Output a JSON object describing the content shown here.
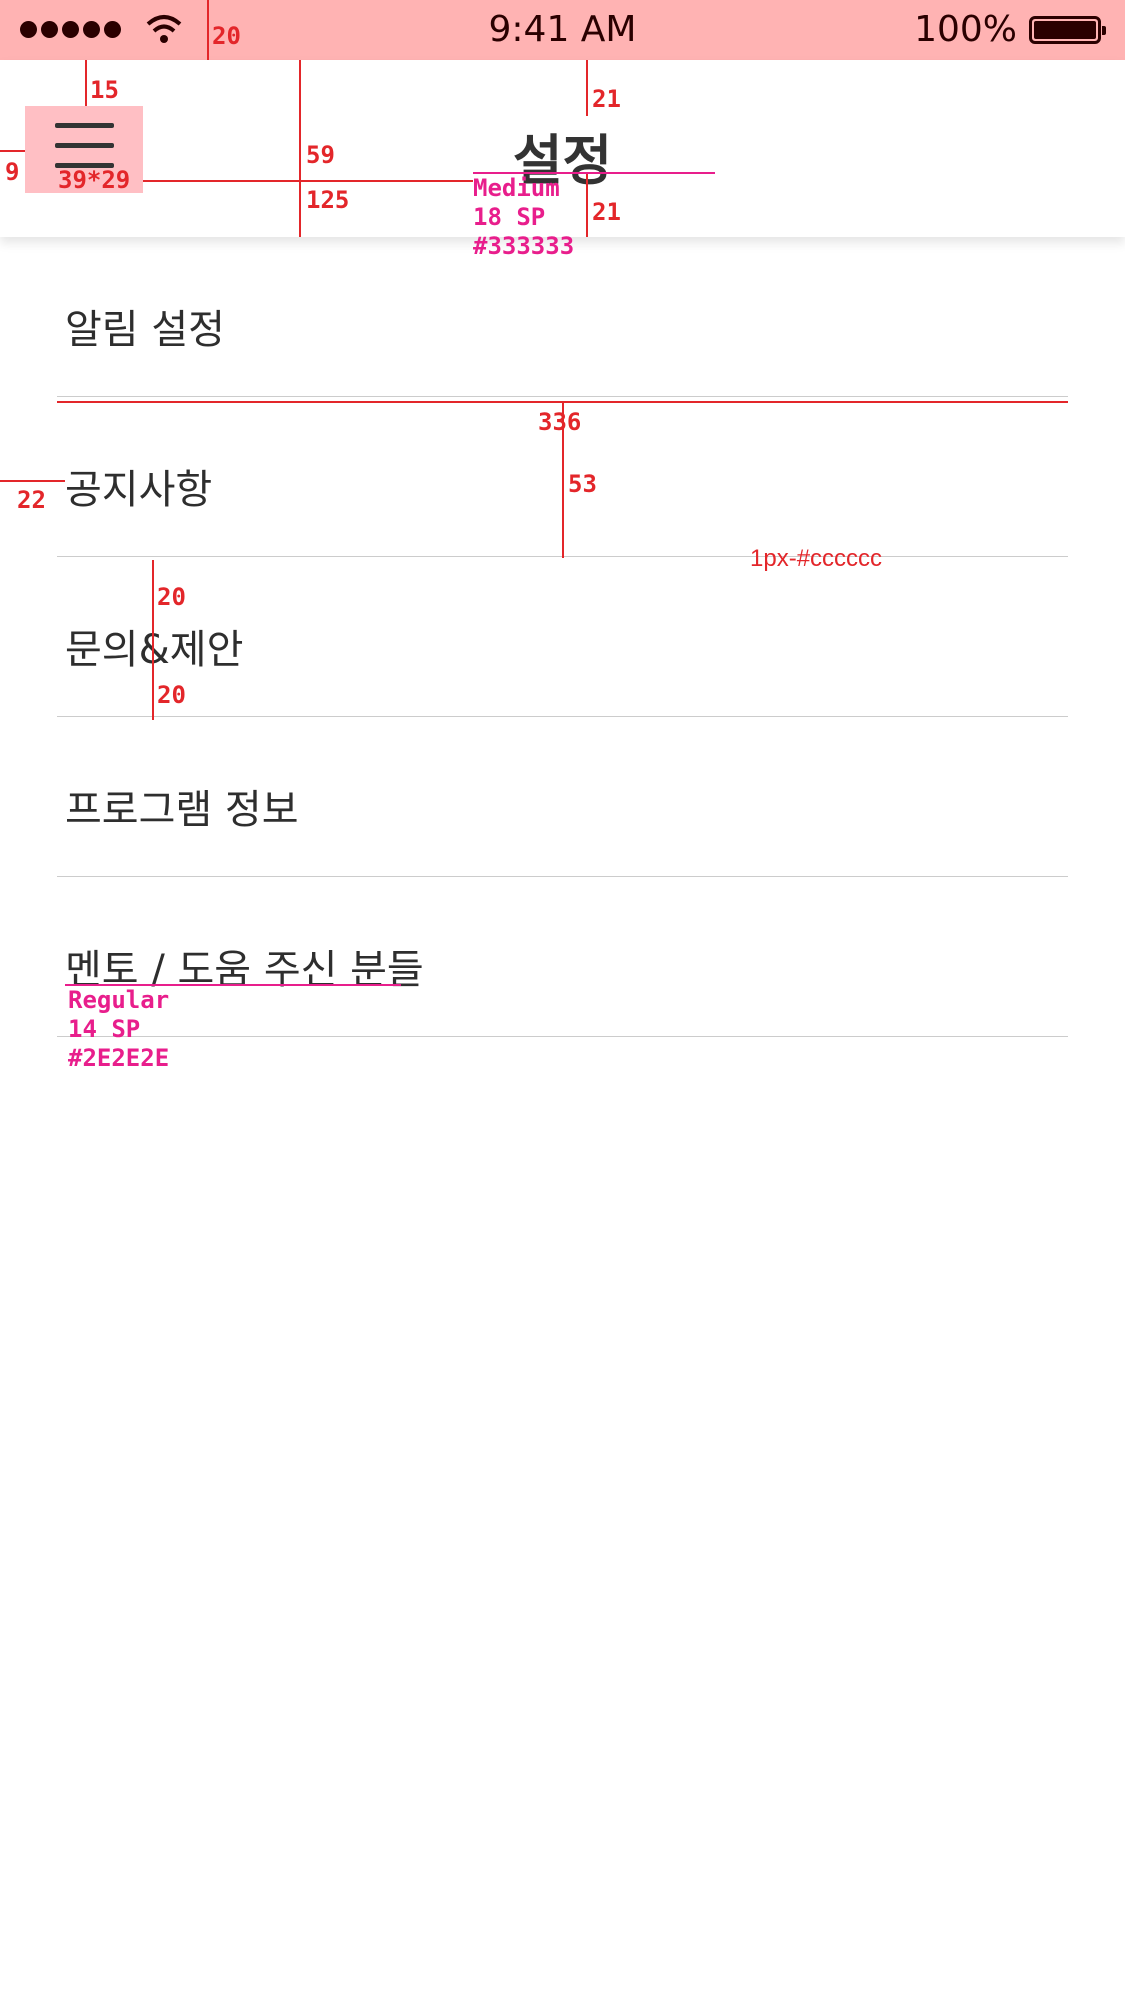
{
  "status_bar": {
    "time": "9:41 AM",
    "battery_percent": "100%"
  },
  "header": {
    "title": "설정"
  },
  "settings_items": [
    {
      "label": "알림 설정"
    },
    {
      "label": "공지사항"
    },
    {
      "label": "문의&제안"
    },
    {
      "label": "프로그램 정보"
    },
    {
      "label": "멘토 / 도움 주신 분들"
    }
  ],
  "spec_annotations": {
    "status_height": "20",
    "menu_top": "15",
    "menu_left": "9",
    "menu_size": "39*29",
    "header_mid": "59",
    "header_height": "125",
    "title_top": "21",
    "title_bottom": "21",
    "title_font": [
      "Medium",
      "18 SP",
      "#333333"
    ],
    "row_width": "336",
    "row_height": "53",
    "row_left": "22",
    "divider_note": "1px-#cccccc",
    "padding_top": "20",
    "padding_bottom": "20",
    "item_font": [
      "Regular",
      "14 SP",
      "#2E2E2E"
    ]
  }
}
